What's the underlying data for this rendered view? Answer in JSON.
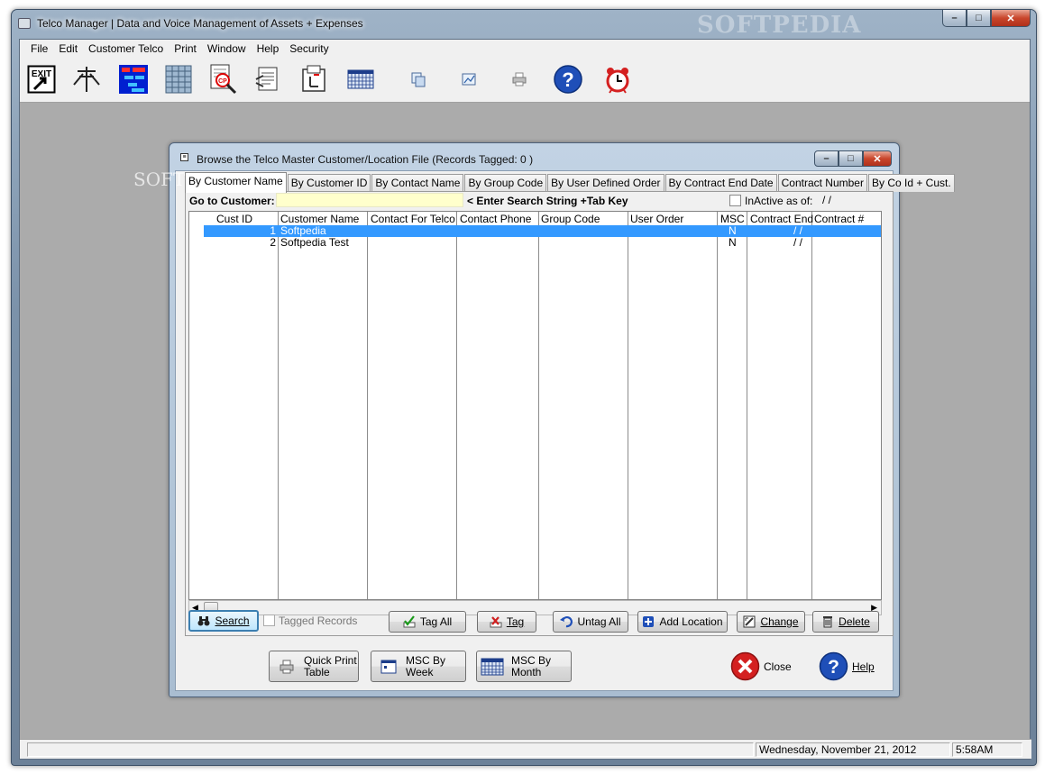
{
  "window": {
    "title": "Telco Manager | Data and Voice Management of Assets + Expenses",
    "watermark": "SOFTPEDIA"
  },
  "menu": [
    "File",
    "Edit",
    "Customer Telco",
    "Print",
    "Window",
    "Help",
    "Security"
  ],
  "toolbar": {
    "exit_label": "EXIT"
  },
  "dialog": {
    "title": "Browse the Telco Master Customer/Location File  (Records Tagged:  0 )",
    "watermark": "SOFTP",
    "tabs": [
      "By Customer Name",
      "By Customer ID",
      "By Contact Name",
      "By Group Code",
      "By User Defined Order",
      "By Contract End Date",
      "Contract Number",
      "By Co Id + Cust."
    ],
    "goto_label": "Go to Customer:",
    "goto_value": "",
    "goto_hint": "< Enter Search String +Tab Key",
    "inactive_label": "InActive as of:",
    "inactive_date": "/  /",
    "columns": [
      "Cust ID",
      "Customer Name",
      "Contact For Telco",
      "Contact Phone",
      "Group Code",
      "User Order",
      "MSC",
      "Contract End",
      "Contract #"
    ],
    "rows": [
      {
        "id": "1",
        "name": "Softpedia",
        "contact": "",
        "phone": "",
        "group": "",
        "order": "",
        "msc": "N",
        "end": "/  /",
        "contract": ""
      },
      {
        "id": "2",
        "name": "Softpedia Test",
        "contact": "",
        "phone": "",
        "group": "",
        "order": "",
        "msc": "N",
        "end": "/  /",
        "contract": ""
      }
    ],
    "buttons": {
      "search": "Search",
      "tagged_records": "Tagged Records",
      "tag_all": "Tag All",
      "tag": "Tag",
      "untag_all": "Untag All",
      "add_location": "Add Location",
      "change": "Change",
      "delete": "Delete"
    },
    "bottom_buttons": {
      "quick_print_1": "Quick Print",
      "quick_print_2": "Table",
      "msc_week_1": "MSC By",
      "msc_week_2": "Week",
      "msc_month_1": "MSC By",
      "msc_month_2": "Month",
      "close": "Close",
      "help": "Help"
    }
  },
  "status": {
    "date": "Wednesday, November 21, 2012",
    "time": "5:58AM"
  },
  "colors": {
    "selection": "#3399ff",
    "search_field": "#ffffcc",
    "help_blue": "#1f4fb8",
    "close_red": "#d42020"
  }
}
